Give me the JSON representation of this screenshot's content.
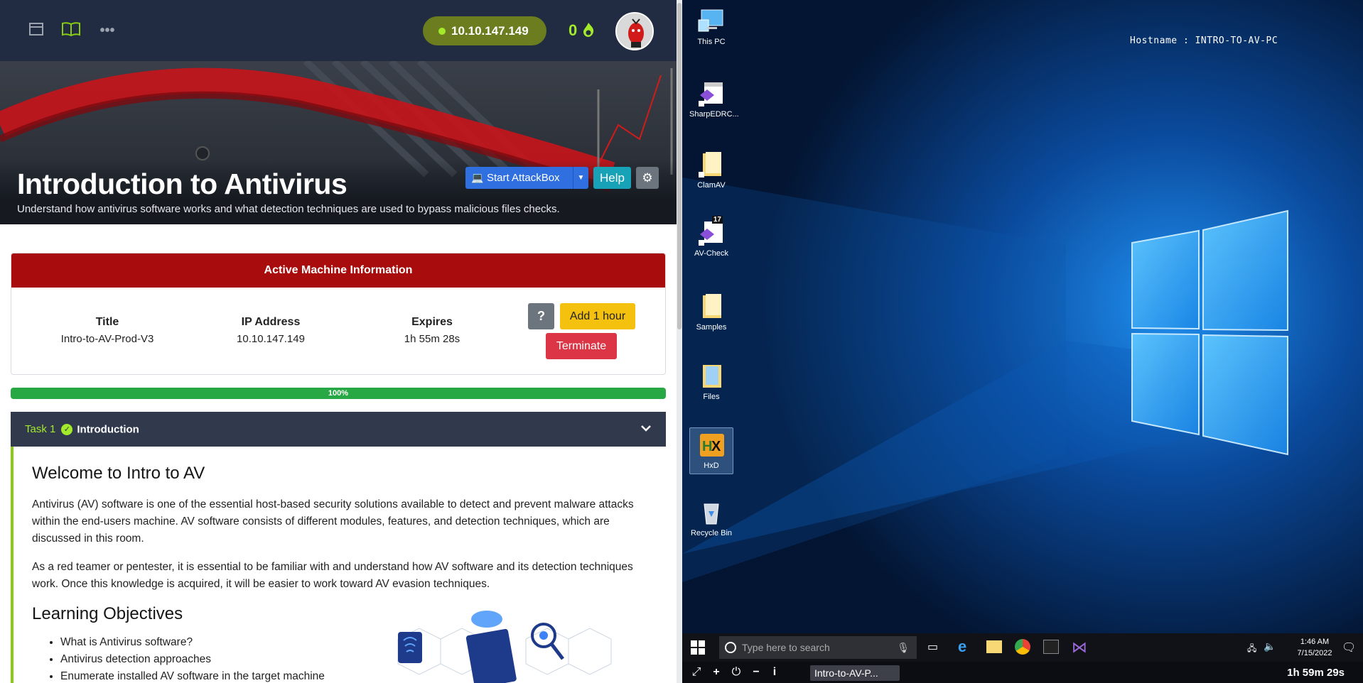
{
  "header": {
    "ip": "10.10.147.149",
    "streak": "0"
  },
  "room": {
    "title": "Introduction to Antivirus",
    "subtitle": "Understand how antivirus software works and what detection techniques are used to bypass malicious files checks.",
    "attack_button": "Start AttackBox",
    "help_button": "Help"
  },
  "machine": {
    "heading": "Active Machine Information",
    "columns": [
      {
        "label": "Title",
        "value": "Intro-to-AV-Prod-V3"
      },
      {
        "label": "IP Address",
        "value": "10.10.147.149"
      },
      {
        "label": "Expires",
        "value": "1h 55m 28s"
      }
    ],
    "help_label": "?",
    "add_hour": "Add 1 hour",
    "terminate": "Terminate"
  },
  "progress": {
    "label": "100%",
    "value": 100
  },
  "task": {
    "number": "Task 1",
    "name": "Introduction",
    "heading": "Welcome to Intro to AV",
    "paragraphs": [
      "Antivirus (AV) software is one of the essential host-based security solutions available to detect and prevent malware attacks within the end-users machine. AV software consists of different modules, features, and detection techniques, which are discussed in this room.",
      "As a red teamer or pentester, it is essential to be familiar with and understand how AV software and its detection techniques work. Once this knowledge is acquired, it will be easier to work toward AV evasion techniques."
    ],
    "objectives_heading": "Learning Objectives",
    "objectives": [
      "What is Antivirus software?",
      "Antivirus detection approaches",
      "Enumerate installed AV software in the target machine"
    ]
  },
  "desktop": {
    "hostname": "Hostname   :  INTRO-TO-AV-PC",
    "icons": [
      "This PC",
      "SharpEDRC...",
      "ClamAV",
      "AV-Check",
      "Samples",
      "Files",
      "HxD",
      "Recycle Bin"
    ],
    "badge": "17",
    "search_placeholder": "Type here to search",
    "clock_time": "1:46 AM",
    "clock_date": "7/15/2022",
    "session_name": "Intro-to-AV-P...",
    "session_timer": "1h 59m 29s"
  }
}
